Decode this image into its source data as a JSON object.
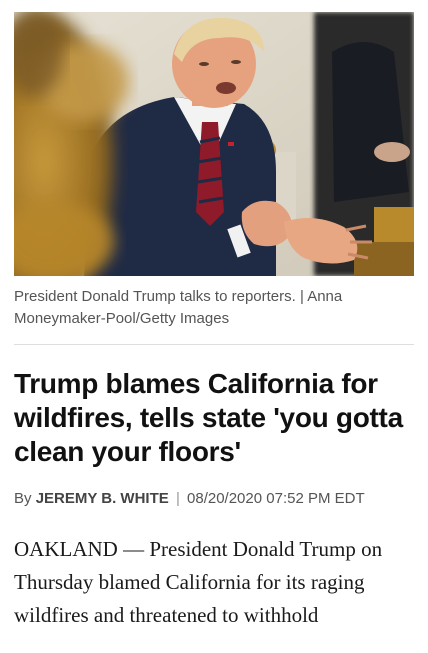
{
  "article": {
    "image_alt": "President Donald Trump talks to reporters.",
    "caption": "President Donald Trump talks to reporters. | Anna Moneymaker-Pool/Getty Images",
    "headline": "Trump blames California for wildfires, tells state 'you gotta clean your floors'",
    "byline": {
      "prefix": "By",
      "author": "JEREMY B. WHITE",
      "separator": "|",
      "datetime": "08/20/2020 07:52 PM EDT"
    },
    "body_lead": "OAKLAND — President Donald Trump on Thursday blamed California for its raging wildfires and threatened to withhold"
  }
}
